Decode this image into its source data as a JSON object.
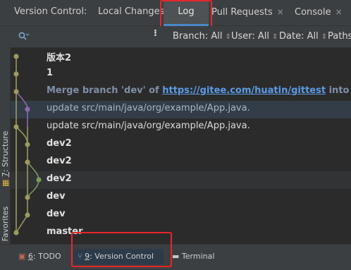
{
  "tabs": [
    {
      "label": "Version Control:",
      "closable": false
    },
    {
      "label": "Local Changes",
      "closable": false
    },
    {
      "label": "Log",
      "closable": false,
      "active": true
    },
    {
      "label": "Pull Requests",
      "closable": true
    },
    {
      "label": "Console",
      "closable": true
    }
  ],
  "close_glyph": "×",
  "filters": {
    "branch": "Branch: All",
    "user": "User: All",
    "date": "Date: All",
    "paths": "Paths"
  },
  "left_strip": {
    "structure_num": "7",
    "structure_label": ": Structure",
    "favorites_num": "2",
    "favorites_label": ": Favorites"
  },
  "commits": [
    {
      "message": "版本2"
    },
    {
      "message": "1"
    },
    {
      "message_pre": "Merge branch 'dev' of ",
      "message_link": "https://gitee.com/huatin/gittest",
      "message_post": " into dev"
    },
    {
      "message": "update src/main/java/org/example/App.java."
    },
    {
      "message": "update src/main/java/org/example/App.java."
    },
    {
      "message": "dev2"
    },
    {
      "message": "dev2"
    },
    {
      "message": "dev2"
    },
    {
      "message": "dev"
    },
    {
      "message": "dev"
    },
    {
      "message": "master"
    }
  ],
  "bottom_tabs": {
    "todo_num": "6",
    "todo_label": ": TODO",
    "vc_num": "9",
    "vc_label": ": Version Control",
    "terminal_label": "Terminal"
  },
  "colors": {
    "accent": "#4a88c7",
    "highlight_box": "#e8262a",
    "graph_olive": "#9c9a5e",
    "graph_purple": "#8a6aa8",
    "graph_green": "#7a9a5a"
  }
}
